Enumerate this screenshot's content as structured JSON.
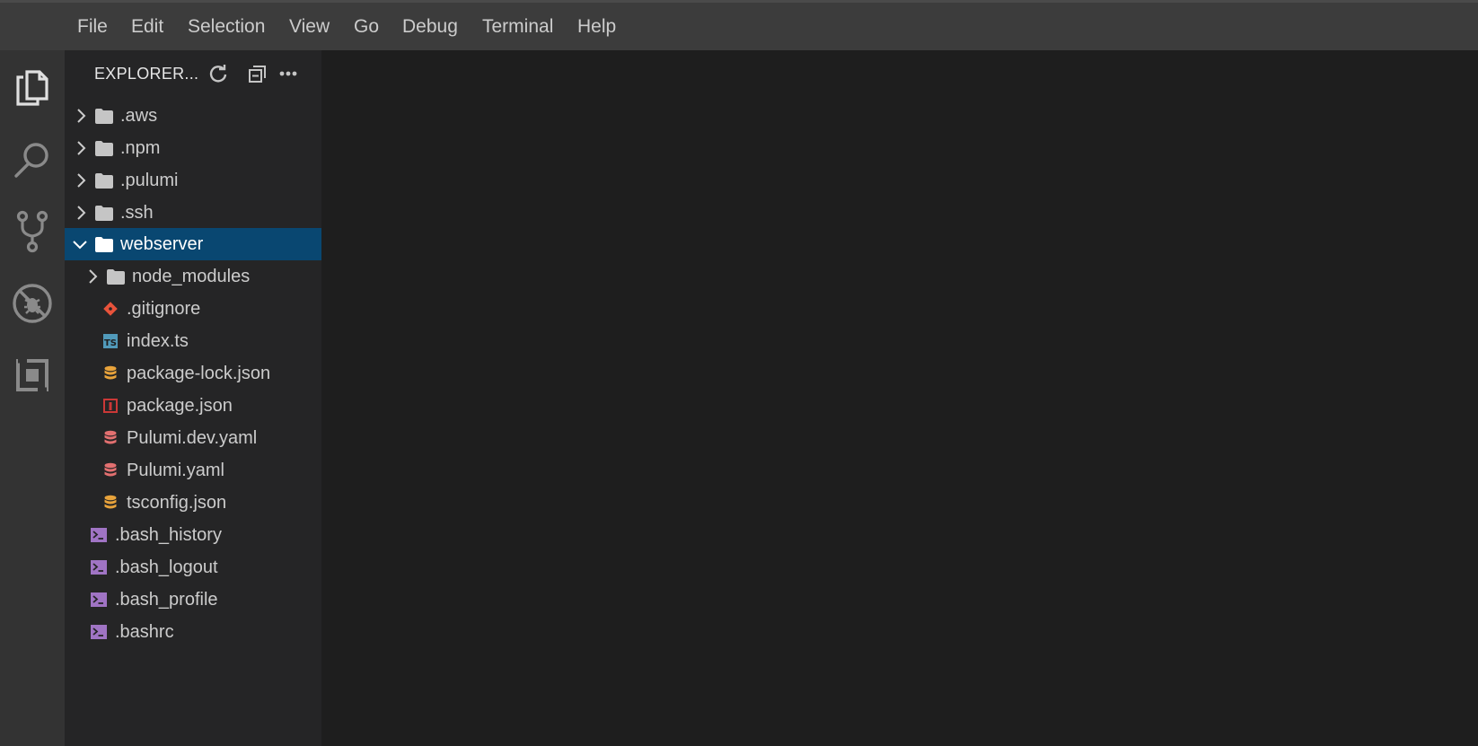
{
  "menu": {
    "items": [
      "File",
      "Edit",
      "Selection",
      "View",
      "Go",
      "Debug",
      "Terminal",
      "Help"
    ]
  },
  "activity_bar": {
    "icons": [
      "files-icon",
      "search-icon",
      "source-control-icon",
      "debug-icon",
      "extensions-icon"
    ]
  },
  "explorer": {
    "title": "EXPLORER...",
    "actions": [
      "refresh-icon",
      "collapse-all-icon",
      "more-icon"
    ],
    "tree": [
      {
        "label": ".aws",
        "type": "folder",
        "expanded": false,
        "depth": 0
      },
      {
        "label": ".npm",
        "type": "folder",
        "expanded": false,
        "depth": 0
      },
      {
        "label": ".pulumi",
        "type": "folder",
        "expanded": false,
        "depth": 0
      },
      {
        "label": ".ssh",
        "type": "folder",
        "expanded": false,
        "depth": 0
      },
      {
        "label": "webserver",
        "type": "folder",
        "expanded": true,
        "depth": 0,
        "selected": true
      },
      {
        "label": "node_modules",
        "type": "folder",
        "expanded": false,
        "depth": 1
      },
      {
        "label": ".gitignore",
        "type": "git",
        "depth": 1
      },
      {
        "label": "index.ts",
        "type": "ts",
        "depth": 1
      },
      {
        "label": "package-lock.json",
        "type": "json",
        "depth": 1
      },
      {
        "label": "package.json",
        "type": "npm",
        "depth": 1
      },
      {
        "label": "Pulumi.dev.yaml",
        "type": "yaml",
        "depth": 1
      },
      {
        "label": "Pulumi.yaml",
        "type": "yaml",
        "depth": 1
      },
      {
        "label": "tsconfig.json",
        "type": "json",
        "depth": 1
      },
      {
        "label": ".bash_history",
        "type": "shell",
        "depth": 0
      },
      {
        "label": ".bash_logout",
        "type": "shell",
        "depth": 0
      },
      {
        "label": ".bash_profile",
        "type": "shell",
        "depth": 0
      },
      {
        "label": ".bashrc",
        "type": "shell",
        "depth": 0
      }
    ]
  },
  "colors": {
    "menubar": "#3c3c3c",
    "activitybar": "#333333",
    "sidebar": "#252526",
    "editor": "#1e1e1e",
    "selection": "#094771",
    "folder_icon": "#c5c5c5",
    "git_icon": "#e8533b",
    "ts_icon": "#519aba",
    "json_icon": "#e8a33b",
    "npm_icon": "#cb3837",
    "yaml_icon": "#e37070",
    "shell_icon": "#a074c4"
  }
}
